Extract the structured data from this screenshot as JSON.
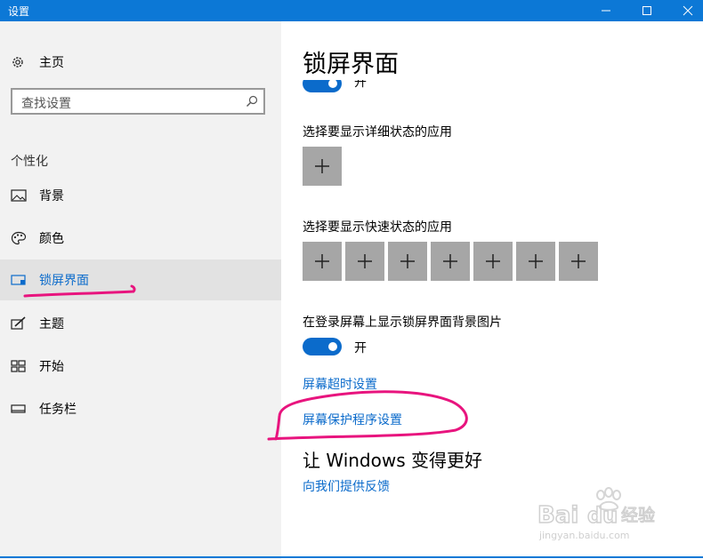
{
  "window": {
    "title": "设置"
  },
  "sidebar": {
    "home_label": "主页",
    "search_placeholder": "查找设置",
    "section_label": "个性化",
    "items": [
      {
        "label": "背景",
        "icon": "image-icon"
      },
      {
        "label": "颜色",
        "icon": "palette-icon"
      },
      {
        "label": "锁屏界面",
        "icon": "lock-screen-icon",
        "active": true
      },
      {
        "label": "主题",
        "icon": "brush-icon"
      },
      {
        "label": "开始",
        "icon": "start-grid-icon"
      },
      {
        "label": "任务栏",
        "icon": "taskbar-icon"
      }
    ]
  },
  "main": {
    "title": "锁屏界面",
    "top_toggle_state": "开",
    "detailed_status_label": "选择要显示详细状态的应用",
    "quick_status_label": "选择要显示快速状态的应用",
    "quick_status_slot_count": 7,
    "background_setting_label": "在登录屏幕上显示锁屏界面背景图片",
    "background_toggle_state": "开",
    "links": {
      "screen_timeout": "屏幕超时设置",
      "screen_saver": "屏幕保护程序设置"
    },
    "improve_heading": "让 Windows 变得更好",
    "feedback_link": "向我们提供反馈"
  },
  "colors": {
    "accent": "#0b6bcb",
    "titlebar": "#0c78d6",
    "annotation": "#e8147e",
    "add_tile": "#a6a6a6"
  },
  "watermark": {
    "brand": "Baidu经验",
    "url": "jingyan.baidu.com"
  }
}
